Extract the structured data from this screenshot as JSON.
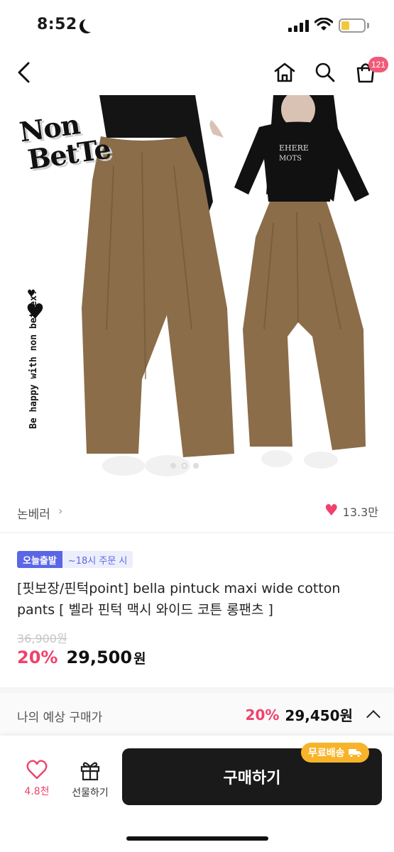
{
  "status_bar": {
    "time": "8:52"
  },
  "nav": {
    "cart_count": "121"
  },
  "hero": {
    "logo_line1": "Non",
    "logo_line2": "BetTe",
    "side_text": "Be happy with non bettex!",
    "image_count": 3,
    "active_image": 1
  },
  "seller": {
    "name": "논베러",
    "chevron": "›",
    "likes": "13.3만"
  },
  "badges": {
    "main": "오늘출발",
    "sub": "~18시 주문 시"
  },
  "product": {
    "title": "[핏보장/핀턱point] bella pintuck maxi wide cotton pants [ 벨라 핀턱 맥시 와이드 코튼 롱팬츠 ]",
    "original_price": "36,900원",
    "discount": "20%",
    "price": "29,500",
    "currency": "원"
  },
  "expected": {
    "label": "나의 예상 구매가",
    "discount": "20%",
    "price": "29,450원"
  },
  "bottom": {
    "wish_count": "4.8천",
    "gift_label": "선물하기",
    "buy_label": "구매하기",
    "free_shipping": "무료배송"
  },
  "colors": {
    "accent_pink": "#f0426b",
    "badge_blue": "#5b66e6",
    "free_ship_orange": "#f7b42a",
    "buy_button": "#1a1a1a"
  }
}
